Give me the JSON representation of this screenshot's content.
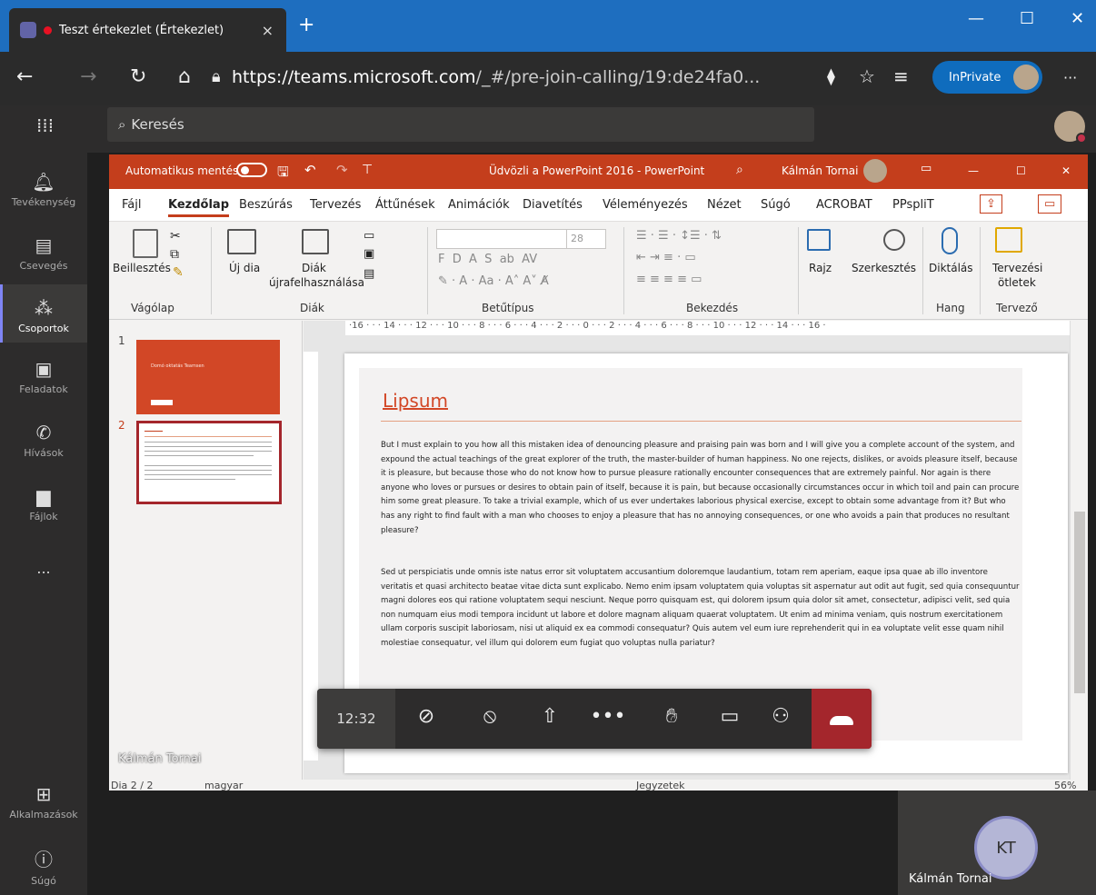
{
  "browser": {
    "tab_title": "Teszt értekezlet (Értekezlet)",
    "tab_close": "×",
    "new_tab": "+",
    "url_host": "https://teams.microsoft.com",
    "url_path": "/_#/pre-join-calling/19:de24fa0...",
    "inprivate": "InPrivate",
    "more": "···"
  },
  "teams": {
    "search_placeholder": "Keresés",
    "rail": [
      {
        "label": "Tevékenység",
        "icon": "bell-icon"
      },
      {
        "label": "Csevegés",
        "icon": "chat-icon"
      },
      {
        "label": "Csoportok",
        "icon": "teams-icon"
      },
      {
        "label": "Feladatok",
        "icon": "assignments-icon"
      },
      {
        "label": "Hívások",
        "icon": "phone-icon"
      },
      {
        "label": "Fájlok",
        "icon": "files-icon"
      },
      {
        "label": "...",
        "icon": "more-icon"
      },
      {
        "label": "Alkalmazások",
        "icon": "apps-icon"
      },
      {
        "label": "Súgó",
        "icon": "help-icon"
      }
    ]
  },
  "ppt": {
    "autosave": "Automatikus mentés",
    "title": "Üdvözli a PowerPoint 2016 - PowerPoint",
    "user": "Kálmán Tornai",
    "menu": [
      "Fájl",
      "Kezdőlap",
      "Beszúrás",
      "Tervezés",
      "Áttűnések",
      "Animációk",
      "Diavetítés",
      "Véleményezés",
      "Nézet",
      "Súgó",
      "ACROBAT",
      "PPspliT"
    ],
    "ribbon": {
      "paste": "Beillesztés",
      "new_slide": "Új dia",
      "reuse_1": "Diák",
      "reuse_2": "újrafelhasználása",
      "font_size": "28",
      "draw": "Rajz",
      "edit": "Szerkesztés",
      "dictate": "Diktálás",
      "designer_1": "Tervezési",
      "designer_2": "ötletek",
      "groups": [
        "Vágólap",
        "Diák",
        "Betűtípus",
        "Bekezdés",
        "Hang",
        "Tervező"
      ]
    },
    "thumb_1_num": "1",
    "thumb_1_title": "Domó oktatás Teamsen",
    "thumb_2_num": "2",
    "ruler": "·16 · · · 14 · · · 12 · · · 10 · · · 8 · · · 6 · · · 4 · · · 2 · · · 0 · · · 2 · · · 4 · · · 6 · · · 8 · · · 10 · · · 12 · · · 14 · · · 16 ·",
    "slide_title": "Lipsum",
    "para1": "But I must explain to you how all this mistaken idea of denouncing pleasure and praising pain was born and I will give you a complete account of the system, and expound the actual teachings of the great explorer of the truth, the master-builder of human happiness. No one rejects, dislikes, or avoids pleasure itself, because it is pleasure, but because those who do not know how to pursue pleasure rationally encounter consequences that are extremely painful. Nor again is there anyone who loves or pursues or desires to obtain pain of itself, because it is pain, but because occasionally circumstances occur in which toil and pain can procure him some great pleasure. To take a trivial example, which of us ever undertakes laborious physical exercise, except to obtain some advantage from it? But who has any right to find fault with a man who chooses to enjoy a pleasure that has no annoying consequences, or one who avoids a pain that produces no resultant pleasure?",
    "para2": "Sed ut perspiciatis unde omnis iste natus error sit voluptatem accusantium doloremque laudantium, totam rem aperiam, eaque ipsa quae ab illo inventore veritatis et quasi architecto beatae vitae dicta sunt explicabo. Nemo enim ipsam voluptatem quia voluptas sit aspernatur aut odit aut fugit, sed quia consequuntur magni dolores eos qui ratione voluptatem sequi nesciunt. Neque porro quisquam est, qui dolorem ipsum quia dolor sit amet, consectetur, adipisci velit, sed quia non numquam eius modi tempora incidunt ut labore et dolore magnam aliquam quaerat voluptatem. Ut enim ad minima veniam, quis nostrum exercitationem ullam corporis suscipit laboriosam, nisi ut aliquid ex ea commodi consequatur? Quis autem vel eum iure reprehenderit qui in ea voluptate velit esse quam nihil molestiae consequatur, vel illum qui dolorem eum fugiat quo voluptas nulla pariatur?",
    "presenter": "Kálmán Tornai",
    "status": {
      "slide": "Dia 2 / 2",
      "lang": "magyar",
      "notes": "Jegyzetek",
      "zoom": "56%"
    }
  },
  "call": {
    "timer": "12:32",
    "self_initials": "KT",
    "self_name": "Kálmán Tornai"
  }
}
